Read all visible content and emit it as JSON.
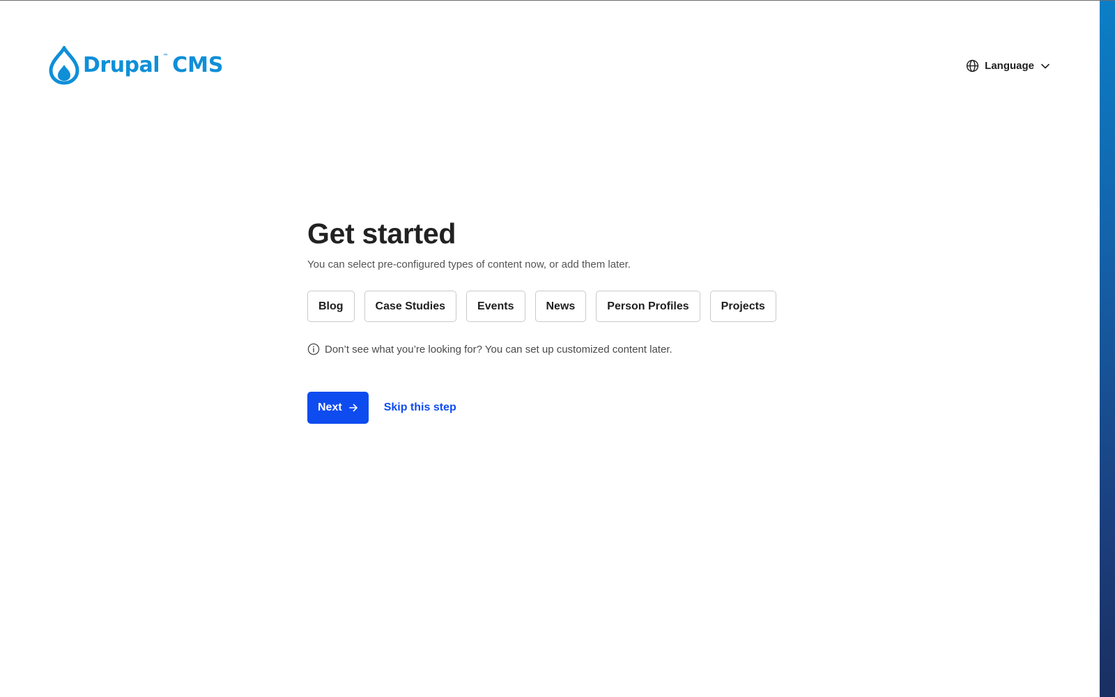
{
  "header": {
    "logo": {
      "word": "Drupal",
      "tm": "™",
      "product": "CMS",
      "icon": "drupal-drop-icon",
      "color": "#0f8fd8"
    },
    "language": {
      "label": "Language",
      "icon": "globe-icon",
      "chevron_icon": "chevron-down-icon"
    }
  },
  "main": {
    "title": "Get started",
    "subtitle": "You can select pre-configured types of content now, or add them later.",
    "content_types": [
      {
        "label": "Blog"
      },
      {
        "label": "Case Studies"
      },
      {
        "label": "Events"
      },
      {
        "label": "News"
      },
      {
        "label": "Person Profiles"
      },
      {
        "label": "Projects"
      }
    ],
    "note": {
      "icon": "info-icon",
      "text": "Don’t see what you’re looking for? You can set up customized content later."
    },
    "actions": {
      "next_label": "Next",
      "next_icon": "arrow-right-icon",
      "skip_label": "Skip this step"
    }
  },
  "colors": {
    "primary": "#0e4cf0",
    "brand": "#0f8fd8",
    "stripe_top": "#0b7fc6",
    "stripe_bottom": "#1a2f61"
  }
}
